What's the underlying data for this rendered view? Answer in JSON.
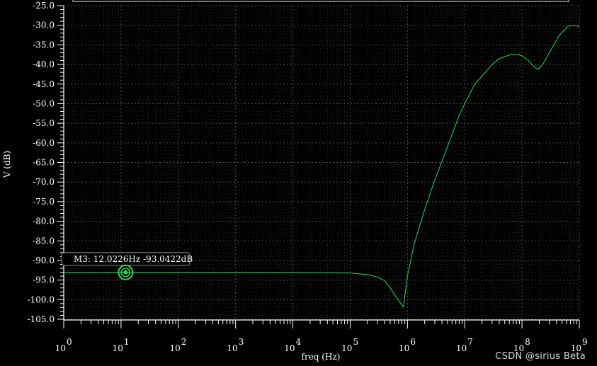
{
  "chart_data": {
    "type": "line",
    "title": "",
    "xlabel": "freq (Hz)",
    "ylabel": "V (dB)",
    "xscale": "log",
    "xlim": [
      1,
      1000000000
    ],
    "ylim": [
      -105.0,
      -25.0
    ],
    "grid": true,
    "yticks": [
      "-25.0",
      "-30.0",
      "-35.0",
      "-40.0",
      "-45.0",
      "-50.0",
      "-55.0",
      "-60.0",
      "-65.0",
      "-70.0",
      "-75.0",
      "-80.0",
      "-85.0",
      "-90.0",
      "-95.0",
      "-100.0",
      "-105.0"
    ],
    "xticks": [
      {
        "base": "10",
        "exp": "0"
      },
      {
        "base": "10",
        "exp": "1"
      },
      {
        "base": "10",
        "exp": "2"
      },
      {
        "base": "10",
        "exp": "3"
      },
      {
        "base": "10",
        "exp": "4"
      },
      {
        "base": "10",
        "exp": "5"
      },
      {
        "base": "10",
        "exp": "6"
      },
      {
        "base": "10",
        "exp": "7"
      },
      {
        "base": "10",
        "exp": "8"
      },
      {
        "base": "10",
        "exp": "9"
      }
    ],
    "series": [
      {
        "color": "#22dd55",
        "points": [
          [
            1,
            -93.04
          ],
          [
            10,
            -93.04
          ],
          [
            100,
            -93.04
          ],
          [
            1000,
            -93.04
          ],
          [
            10000,
            -93.04
          ],
          [
            100000,
            -93.2
          ],
          [
            200000,
            -93.6
          ],
          [
            300000,
            -94.2
          ],
          [
            400000,
            -95.2
          ],
          [
            500000,
            -97.0
          ],
          [
            600000,
            -98.8
          ],
          [
            700000,
            -100.2
          ],
          [
            850000,
            -101.8
          ],
          [
            1000000,
            -94.0
          ],
          [
            1300000,
            -86.0
          ],
          [
            2000000,
            -77.0
          ],
          [
            3000000,
            -69.5
          ],
          [
            5000000,
            -61.0
          ],
          [
            8000000,
            -53.0
          ],
          [
            10000000,
            -50.0
          ],
          [
            15000000,
            -45.0
          ],
          [
            20000000,
            -43.0
          ],
          [
            30000000,
            -40.0
          ],
          [
            40000000,
            -38.5
          ],
          [
            60000000,
            -37.6
          ],
          [
            80000000,
            -37.4
          ],
          [
            100000000,
            -37.8
          ],
          [
            130000000,
            -39.0
          ],
          [
            160000000,
            -40.5
          ],
          [
            190000000,
            -41.3
          ],
          [
            230000000,
            -40.0
          ],
          [
            300000000,
            -37.0
          ],
          [
            450000000,
            -32.5
          ],
          [
            650000000,
            -30.2
          ],
          [
            750000000,
            -30.0
          ],
          [
            1000000000,
            -30.3
          ]
        ]
      }
    ],
    "marker": {
      "label": "M3: 12.0226Hz -93.0422dB",
      "x": 12.0226,
      "y": -93.0422,
      "color": "#22dd55"
    }
  },
  "watermark": "CSDN @sirius   Beta"
}
